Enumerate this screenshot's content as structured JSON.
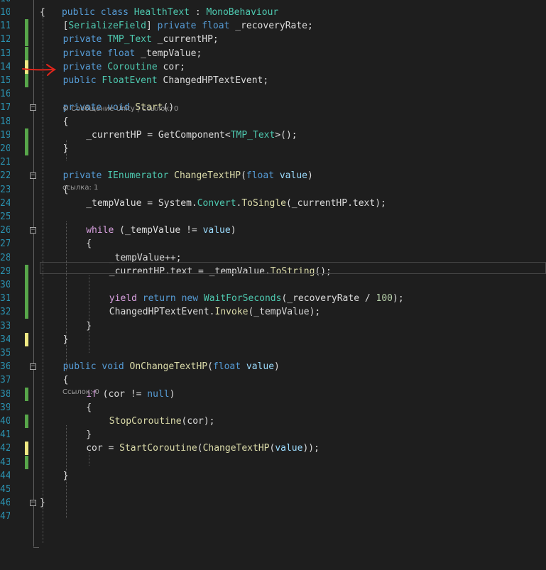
{
  "editor": {
    "header_line": {
      "number": "10",
      "text": "public class HealthText : MonoBehaviour"
    },
    "lines": [
      {
        "n": "10",
        "t": "{"
      },
      {
        "n": "11",
        "t": "[SerializeField] private float _recoveryRate;"
      },
      {
        "n": "12",
        "t": "private TMP_Text _currentHP;"
      },
      {
        "n": "13",
        "t": "private float _tempValue;"
      },
      {
        "n": "14",
        "t": "private Coroutine cor;"
      },
      {
        "n": "15",
        "t": "public FloatEvent ChangedHPTextEvent;"
      },
      {
        "n": "16",
        "t": ""
      },
      {
        "n": "17",
        "t": "private void Start()"
      },
      {
        "n": "18",
        "t": "{"
      },
      {
        "n": "19",
        "t": "_currentHP = GetComponent<TMP_Text>();"
      },
      {
        "n": "20",
        "t": "}"
      },
      {
        "n": "21",
        "t": ""
      },
      {
        "n": "22",
        "t": "private IEnumerator ChangeTextHP(float value)"
      },
      {
        "n": "23",
        "t": "{"
      },
      {
        "n": "24",
        "t": "_tempValue = System.Convert.ToSingle(_currentHP.text);"
      },
      {
        "n": "25",
        "t": ""
      },
      {
        "n": "26",
        "t": "while (_tempValue != value)"
      },
      {
        "n": "27",
        "t": "{"
      },
      {
        "n": "28",
        "t": "_tempValue++;"
      },
      {
        "n": "29",
        "t": "_currentHP.text = _tempValue.ToString();"
      },
      {
        "n": "30",
        "t": ""
      },
      {
        "n": "31",
        "t": "yield return new WaitForSeconds(_recoveryRate / 100);"
      },
      {
        "n": "32",
        "t": "ChangedHPTextEvent.Invoke(_tempValue);"
      },
      {
        "n": "33",
        "t": "}"
      },
      {
        "n": "34",
        "t": "}"
      },
      {
        "n": "35",
        "t": ""
      },
      {
        "n": "36",
        "t": "public void OnChangeTextHP(float value)"
      },
      {
        "n": "37",
        "t": "{"
      },
      {
        "n": "38",
        "t": "if (cor != null)"
      },
      {
        "n": "39",
        "t": "{"
      },
      {
        "n": "40",
        "t": "StopCoroutine(cor);"
      },
      {
        "n": "41",
        "t": "}"
      },
      {
        "n": "42",
        "t": "cor = StartCoroutine(ChangeTextHP(value));"
      },
      {
        "n": "43",
        "t": ""
      },
      {
        "n": "44",
        "t": "}"
      },
      {
        "n": "45",
        "t": ""
      },
      {
        "n": "46",
        "t": "}"
      },
      {
        "n": "47",
        "t": ""
      }
    ],
    "codelens": {
      "start": "⚙ Сообщение Unity | Ссылок: 0",
      "change_text_hp": "ссылка: 1",
      "on_change_text_hp": "Ссылок: 0"
    },
    "colors": {
      "background": "#1e1e1e",
      "keyword": "#569cd6",
      "type": "#4ec9b0",
      "method": "#dcdcaa",
      "number": "#b5cea8",
      "parameter": "#9cdcfe",
      "control": "#d8a0df",
      "line_number": "#2b91af",
      "change_saved": "#57a64a",
      "change_unsaved": "#efe983",
      "annotation": "#e0251b"
    },
    "annotation_icon": "red-arrow-icon"
  }
}
